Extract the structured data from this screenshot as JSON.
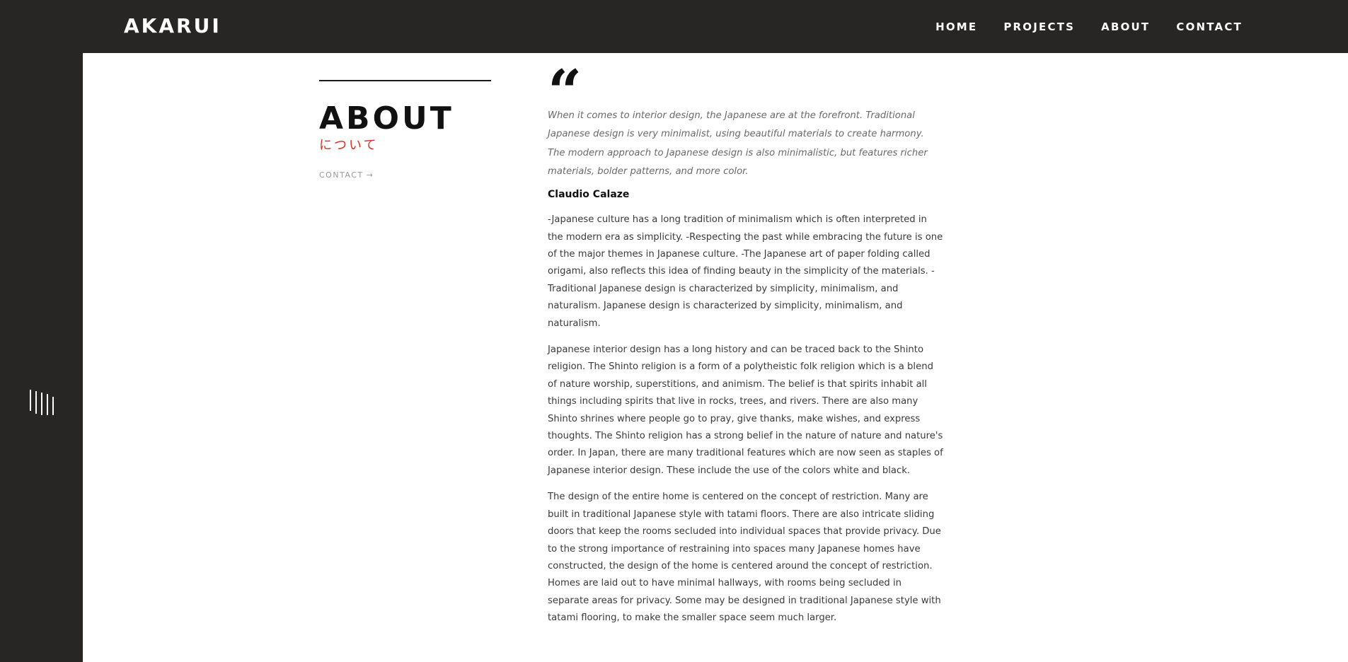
{
  "header": {
    "logo": "AKARUI",
    "nav": [
      "HOME",
      "PROJECTS",
      "ABOUT",
      "CONTACT"
    ]
  },
  "sidebar": {
    "menu_icon": "vertical-lines-menu-icon"
  },
  "about": {
    "title": "ABOUT",
    "subtitle_jp": "について",
    "contact_link": "CONTACT",
    "contact_arrow": "→"
  },
  "article": {
    "quote_mark": "“",
    "quote": "When it comes to interior design, the Japanese are at the forefront. Traditional Japanese design is very minimalist, using beautiful materials to create harmony. The modern approach to Japanese design is also minimalistic, but features richer materials, bolder patterns, and more color.",
    "author": "Claudio Calaze",
    "paragraphs": [
      "-Japanese culture has a long tradition of minimalism which is often interpreted in the modern era as simplicity. -Respecting the past while embracing the future is one of the major themes in Japanese culture. -The Japanese art of paper folding called origami, also reflects this idea of finding beauty in the simplicity of the materials. -Traditional Japanese design is characterized by simplicity, minimalism, and naturalism. Japanese design is characterized by simplicity, minimalism, and naturalism.",
      "Japanese interior design has a long history and can be traced back to the Shinto religion. The Shinto religion is a form of a polytheistic folk religion which is a blend of nature worship, superstitions, and animism. The belief is that spirits inhabit all things including spirits that live in rocks, trees, and rivers. There are also many Shinto shrines where people go to pray, give thanks, make wishes, and express thoughts. The Shinto religion has a strong belief in the nature of nature and nature's order. In Japan, there are many traditional features which are now seen as staples of Japanese interior design. These include the use of the colors white and black.",
      "The design of the entire home is centered on the concept of restriction. Many are built in traditional Japanese style with tatami floors. There are also intricate sliding doors that keep the rooms secluded into individual spaces that provide privacy. Due to the strong importance of restraining into spaces many Japanese homes have constructed, the design of the home is centered around the concept of restriction. Homes are laid out to have minimal hallways, with rooms being secluded in separate areas for privacy. Some may be designed in traditional Japanese style with tatami flooring, to make the smaller space seem much larger."
    ]
  }
}
